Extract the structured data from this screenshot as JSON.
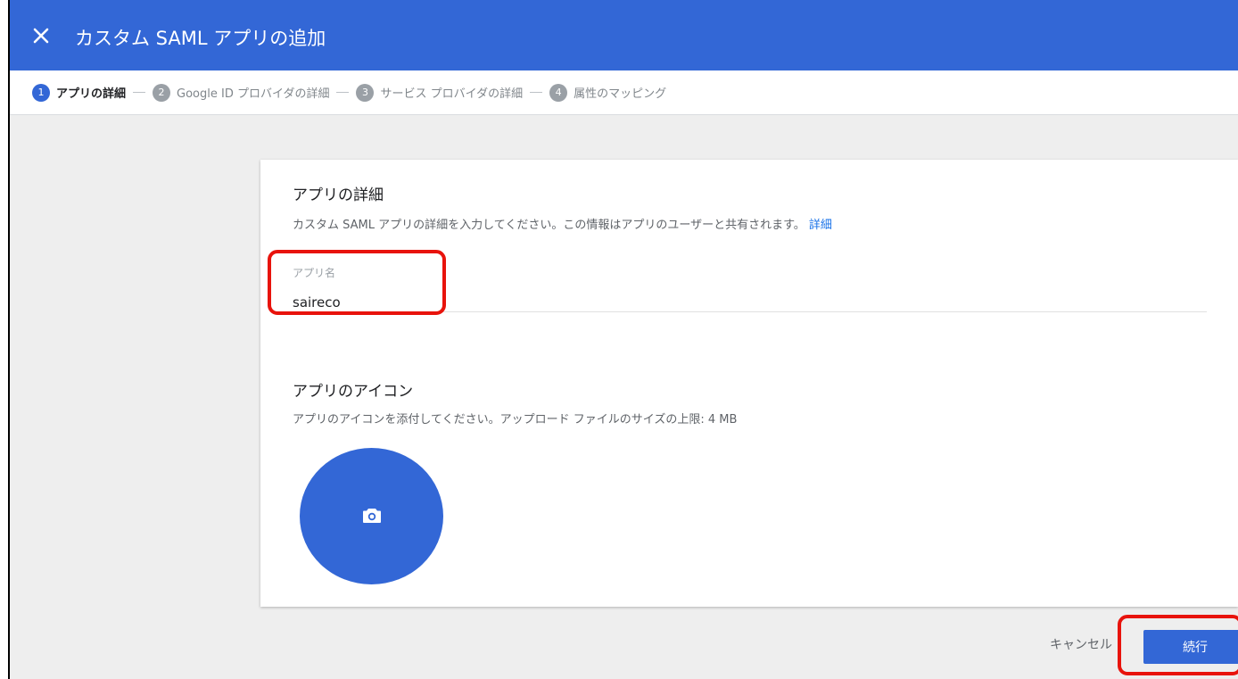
{
  "header": {
    "title": "カスタム SAML アプリの追加",
    "close_icon": "close-icon",
    "color": "#3367d6"
  },
  "stepper": {
    "steps": [
      {
        "number": "1",
        "label": "アプリの詳細",
        "active": true
      },
      {
        "number": "2",
        "label": "Google ID プロバイダの詳細",
        "active": false
      },
      {
        "number": "3",
        "label": "サービス プロバイダの詳細",
        "active": false
      },
      {
        "number": "4",
        "label": "属性のマッピング",
        "active": false
      }
    ]
  },
  "app_details": {
    "title": "アプリの詳細",
    "description": "カスタム SAML アプリの詳細を入力してください。この情報はアプリのユーザーと共有されます。",
    "link": "詳細",
    "app_name_label": "アプリ名",
    "app_name_value": "saireco"
  },
  "app_icon": {
    "title": "アプリのアイコン",
    "description": "アプリのアイコンを添付してください。アップロード ファイルのサイズの上限: 4 MB",
    "icon": "camera-icon"
  },
  "footer": {
    "cancel_label": "キャンセル",
    "continue_label": "続行"
  },
  "colors": {
    "accent": "#3367d6",
    "highlight": "#e8130c",
    "background": "#eeeeee"
  }
}
